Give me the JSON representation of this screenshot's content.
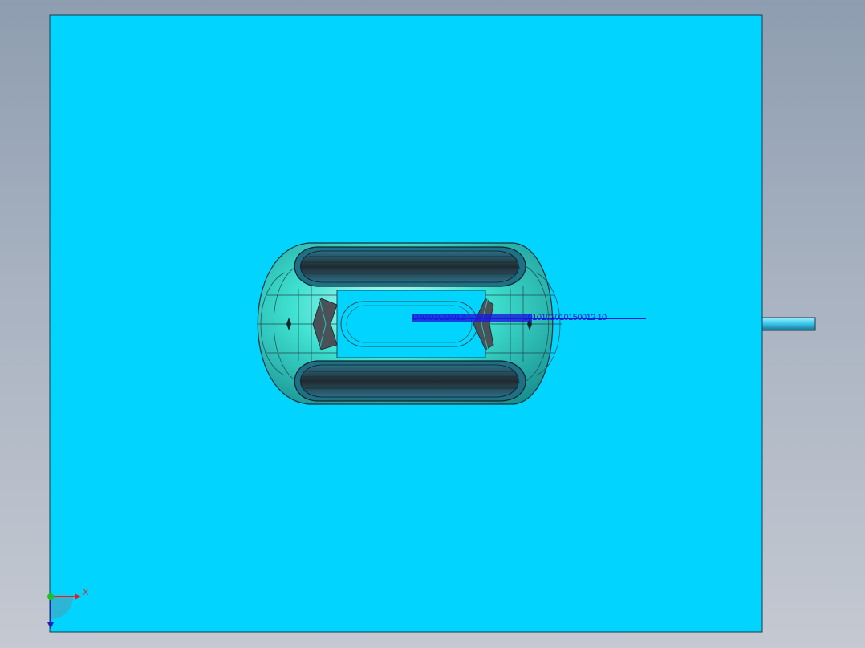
{
  "viewport": {
    "background_top": "#8e9db0",
    "background_bottom": "#c4c9d2"
  },
  "mold_plate": {
    "fill": "#00d4ff",
    "edge": "#1a3a4a"
  },
  "part": {
    "shell_color": "#3ee0d0",
    "pad_color": "#2a2e33",
    "pad_stripe_color": "#1f6f85",
    "window_color": "#00d4ff",
    "pocket_color": "#555c63"
  },
  "runner": {
    "color": "#36c4e8"
  },
  "label": {
    "text_a": "D:\\0\\01\\02\\012",
    "text_b": "1010102010150012 10"
  },
  "triad": {
    "x_label": "X",
    "x_color": "#e02020",
    "y_color": "#20c020",
    "z_color": "#2020c0"
  }
}
